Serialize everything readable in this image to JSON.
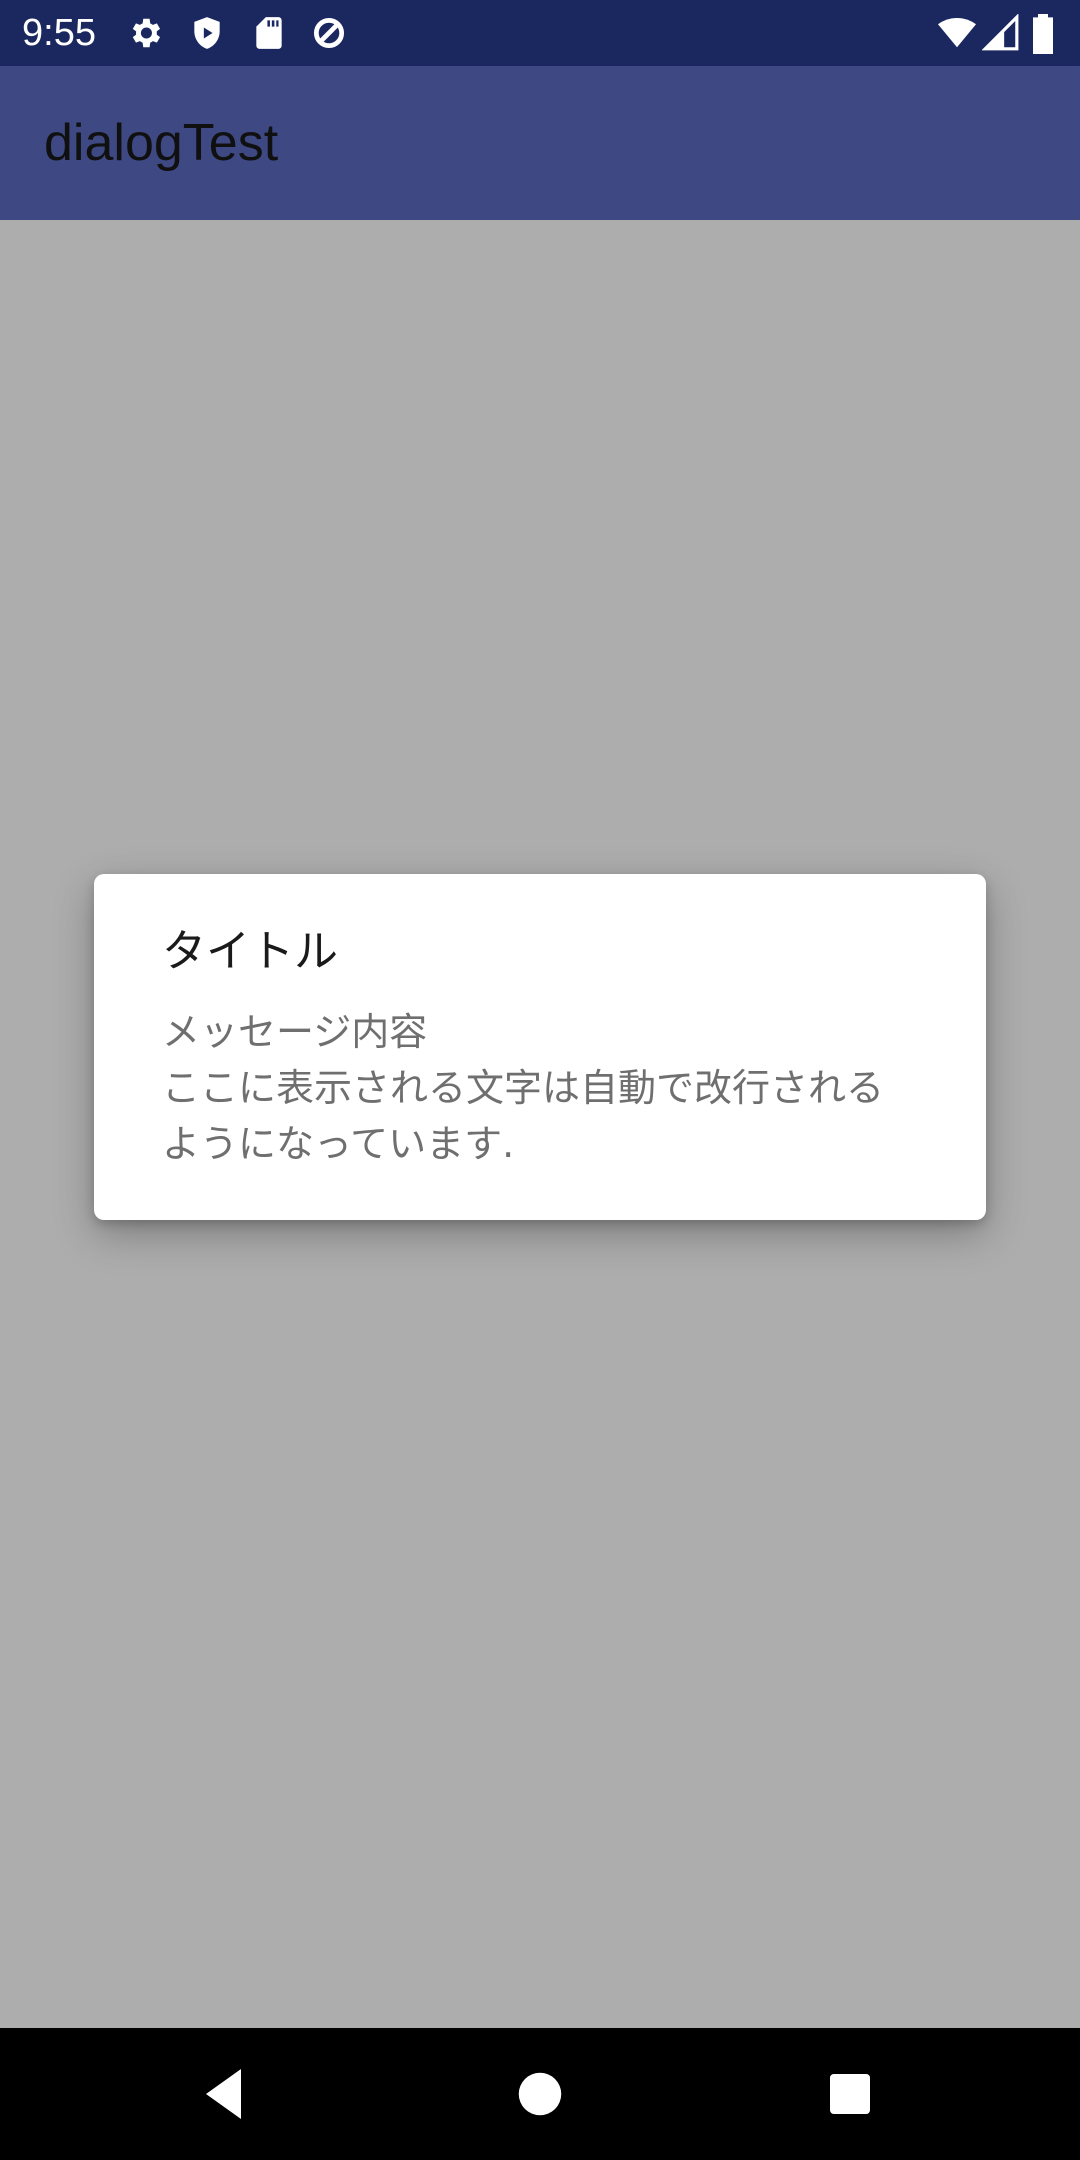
{
  "status_bar": {
    "time": "9:55",
    "icons_left": [
      "settings-icon",
      "shield-play-icon",
      "sd-card-icon",
      "data-saver-icon"
    ],
    "icons_right": [
      "wifi-icon",
      "cellular-signal-icon",
      "battery-icon"
    ],
    "color": "#1b2860"
  },
  "app_bar": {
    "title": "dialogTest",
    "color": "#3e4984"
  },
  "dialog": {
    "title": "タイトル",
    "message": "メッセージ内容\nここに表示される文字は自動で改行される\nようになっています."
  },
  "nav_bar": {
    "buttons": [
      "back-icon",
      "home-icon",
      "recents-icon"
    ]
  }
}
